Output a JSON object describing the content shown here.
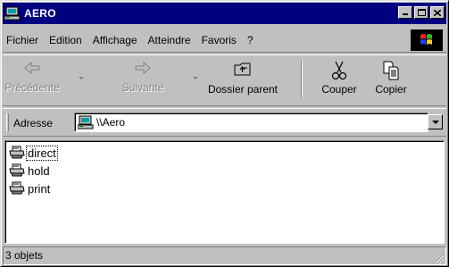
{
  "window": {
    "title": "AERO",
    "icon": "network-computer-icon",
    "controls": [
      "minimize-icon",
      "maximize-icon",
      "close-icon"
    ]
  },
  "menu": {
    "items": [
      {
        "label": "Fichier"
      },
      {
        "label": "Edition"
      },
      {
        "label": "Affichage"
      },
      {
        "label": "Atteindre"
      },
      {
        "label": "Favoris"
      },
      {
        "label": "?"
      }
    ],
    "logo": "windows-flag-icon"
  },
  "toolbar": {
    "back": {
      "label": "Précédente",
      "icon": "back-arrow-icon",
      "enabled": false
    },
    "forward": {
      "label": "Suivante",
      "icon": "forward-arrow-icon",
      "enabled": false
    },
    "up": {
      "label": "Dossier parent",
      "icon": "folder-up-icon",
      "enabled": true
    },
    "cut": {
      "label": "Couper",
      "icon": "scissors-icon",
      "enabled": true
    },
    "copy": {
      "label": "Copier",
      "icon": "copy-icon",
      "enabled": true
    }
  },
  "address": {
    "label": "Adresse",
    "value": "\\\\Aero",
    "icon": "network-computer-icon"
  },
  "files": [
    {
      "name": "direct",
      "icon": "printer-icon",
      "focused": true
    },
    {
      "name": "hold",
      "icon": "printer-icon",
      "focused": false
    },
    {
      "name": "print",
      "icon": "printer-icon",
      "focused": false
    }
  ],
  "status": {
    "text": "3 objets"
  },
  "colors": {
    "titlebar": "#000080",
    "face": "#c0c0c0",
    "window": "#ffffff"
  }
}
